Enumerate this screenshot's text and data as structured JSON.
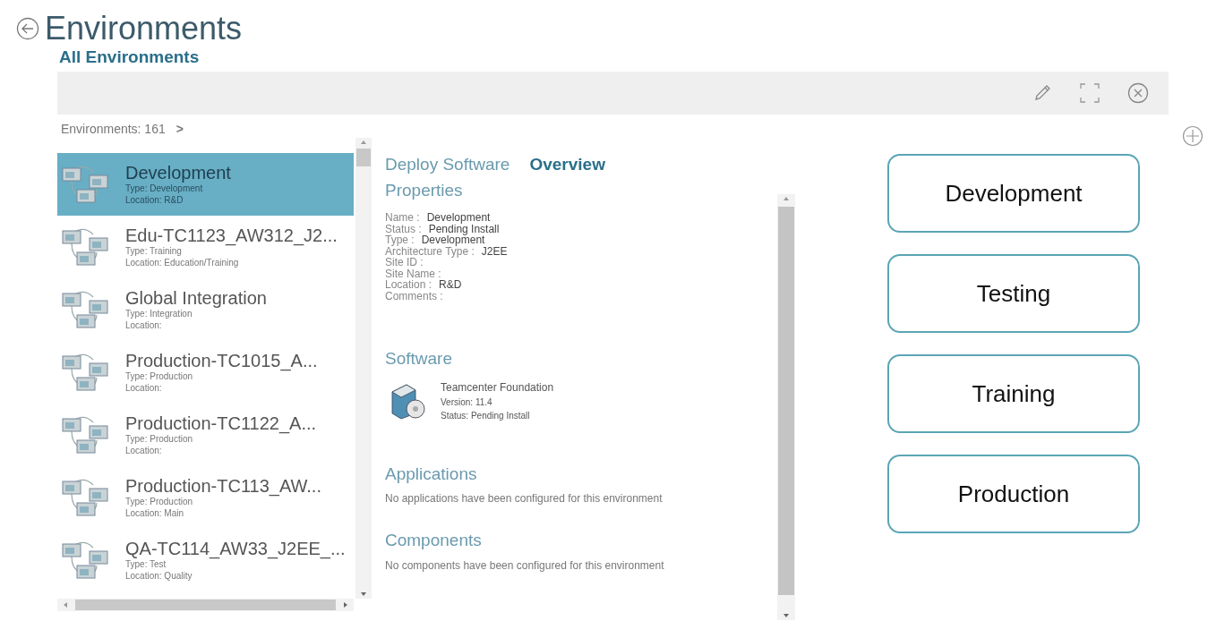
{
  "header": {
    "title": "Environments",
    "subtitle": "All Environments"
  },
  "count": {
    "label": "Environments: 161",
    "arrow": ">"
  },
  "environments": [
    {
      "name": "Development",
      "type": "Type:  Development",
      "location": "Location:  R&D",
      "selected": true
    },
    {
      "name": "Edu-TC1123_AW312_J2...",
      "type": "Type:  Training",
      "location": "Location:  Education/Training",
      "selected": false
    },
    {
      "name": "Global Integration",
      "type": "Type:  Integration",
      "location": "Location:",
      "selected": false
    },
    {
      "name": "Production-TC1015_A...",
      "type": "Type:  Production",
      "location": "Location:",
      "selected": false
    },
    {
      "name": "Production-TC1122_A...",
      "type": "Type:  Production",
      "location": "Location:",
      "selected": false
    },
    {
      "name": "Production-TC113_AW...",
      "type": "Type:  Production",
      "location": "Location:  Main",
      "selected": false
    },
    {
      "name": "QA-TC114_AW33_J2EE_...",
      "type": "Type:  Test",
      "location": "Location:  Quality",
      "selected": false
    }
  ],
  "tabs": [
    {
      "label": "Deploy Software",
      "selected": false
    },
    {
      "label": "Overview",
      "selected": true
    }
  ],
  "properties": {
    "heading": "Properties",
    "rows": [
      {
        "label": "Name :",
        "value": "Development"
      },
      {
        "label": "Status :",
        "value": "Pending Install"
      },
      {
        "label": "Type :",
        "value": "Development"
      },
      {
        "label": "Architecture Type :",
        "value": "J2EE"
      },
      {
        "label": "Site ID :"
      },
      {
        "label": "Site Name :"
      },
      {
        "label": "Location :",
        "value": "R&D"
      },
      {
        "label": "Comments :"
      }
    ]
  },
  "software": {
    "heading": "Software",
    "items": [
      {
        "name": "Teamcenter Foundation",
        "version": "Version:  11.4",
        "status": "Status:  Pending Install"
      }
    ]
  },
  "applications": {
    "heading": "Applications",
    "message": "No applications have been configured for this environment"
  },
  "components": {
    "heading": "Components",
    "message": "No components have been configured for this environment"
  },
  "stages": [
    "Development",
    "Testing",
    "Training",
    "Production"
  ]
}
